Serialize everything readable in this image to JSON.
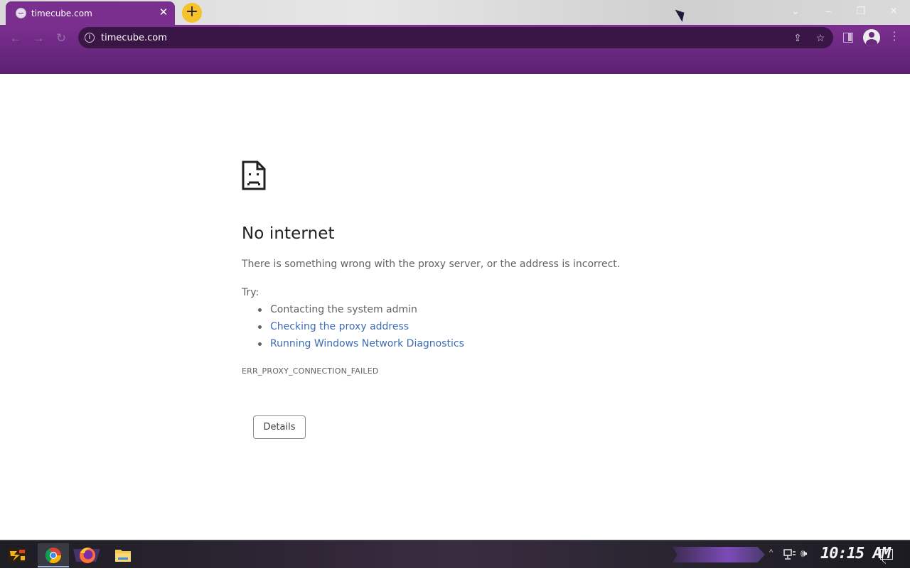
{
  "browser": {
    "tab": {
      "title": "timecube.com",
      "close_glyph": "✕"
    },
    "new_tab_glyph": "+",
    "window_controls": {
      "dropdown": "⌄",
      "minimize": "–",
      "restore": "❐",
      "close": "✕"
    },
    "nav": {
      "back": "←",
      "forward": "→",
      "reload": "↻"
    },
    "omnibox": {
      "url": "timecube.com",
      "info_glyph": "i",
      "share_glyph": "⇪",
      "star_glyph": "☆"
    },
    "menu_glyph": "⋮",
    "theme_color": "#6a2880"
  },
  "error_page": {
    "heading": "No internet",
    "message": "There is something wrong with the proxy server, or the address is incorrect.",
    "try_label": "Try:",
    "suggestions": [
      {
        "text": "Contacting the system admin",
        "is_link": false
      },
      {
        "text": "Checking the proxy address",
        "is_link": true
      },
      {
        "text": "Running Windows Network Diagnostics",
        "is_link": true
      }
    ],
    "error_code": "ERR_PROXY_CONNECTION_FAILED",
    "details_button": "Details",
    "link_color": "#3c6db4"
  },
  "taskbar": {
    "apps": [
      "start-icon",
      "chrome-icon",
      "firefox-icon",
      "file-explorer-icon"
    ],
    "tray": {
      "chevron": "^",
      "volume_glyph": "🕪"
    },
    "clock": "10:15 AM"
  }
}
